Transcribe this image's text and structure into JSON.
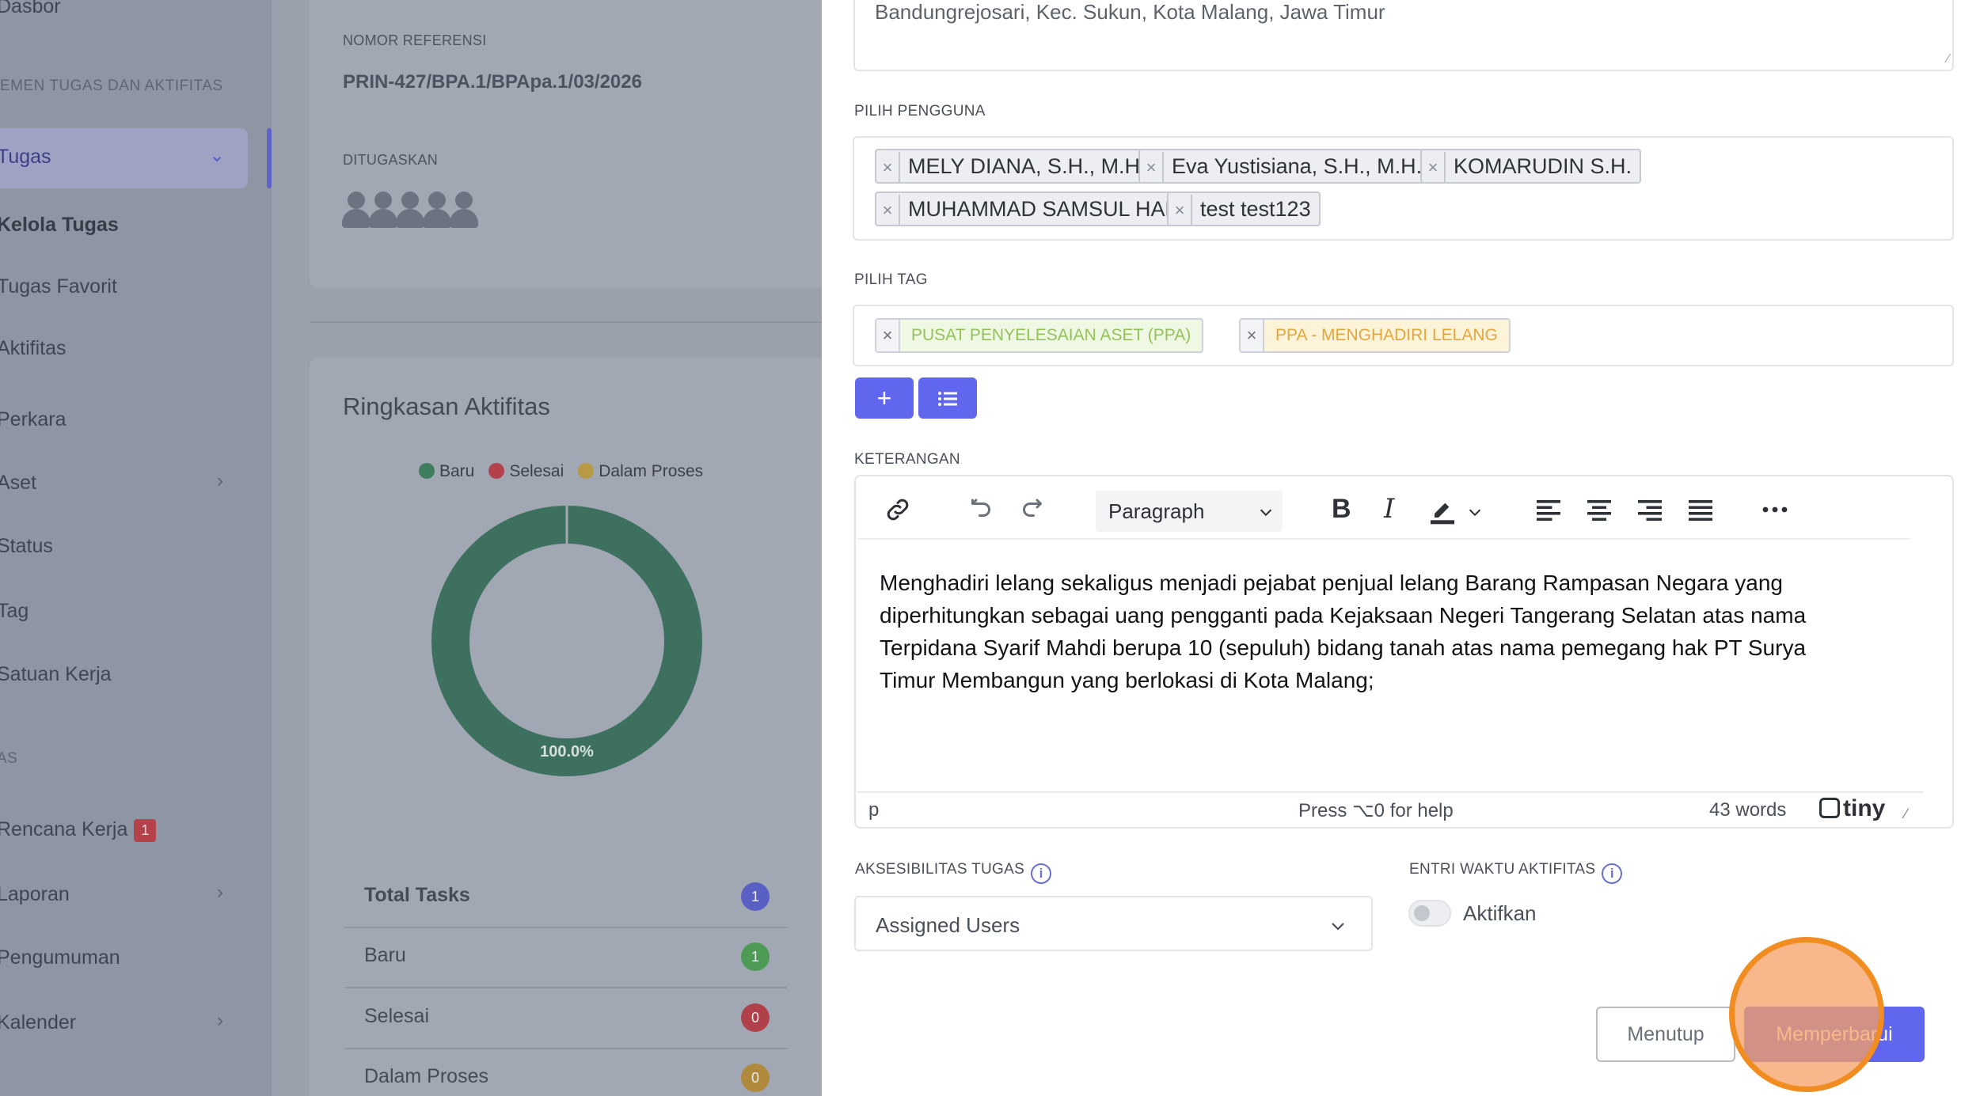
{
  "sidebar": {
    "items": [
      {
        "label": "Dasbor"
      },
      {
        "label": "Tugas"
      },
      {
        "label": "Kelola Tugas"
      },
      {
        "label": "Tugas Favorit"
      },
      {
        "label": "Aktifitas"
      },
      {
        "label": "Perkara"
      },
      {
        "label": "Aset"
      },
      {
        "label": "Status"
      },
      {
        "label": "Tag"
      },
      {
        "label": "Satuan Kerja"
      },
      {
        "label": "Rencana Kerja",
        "badge": "1"
      },
      {
        "label": "Laporan"
      },
      {
        "label": "Pengumuman"
      },
      {
        "label": "Kalender"
      }
    ],
    "sections": [
      "EMEN TUGAS DAN AKTIFITAS",
      "AS"
    ]
  },
  "task_card": {
    "ref_caption": "NOMOR REFERENSI",
    "ref_value": "PRIN-427/BPA.1/BPApa.1/03/2026",
    "assigned_caption": "DITUGASKAN"
  },
  "summary": {
    "title": "Ringkasan Aktifitas",
    "legend": [
      {
        "name": "Baru",
        "color": "#3e7d5e"
      },
      {
        "name": "Selesai",
        "color": "#b4424c"
      },
      {
        "name": "Dalam Proses",
        "color": "#b89a45"
      }
    ],
    "donut_label": "100.0%",
    "stats": [
      {
        "label": "Total Tasks",
        "count": "1",
        "color": "#5a5fc4",
        "bold": true
      },
      {
        "label": "Baru",
        "count": "1",
        "color": "#4d9b54"
      },
      {
        "label": "Selesai",
        "count": "0",
        "color": "#b0404a"
      },
      {
        "label": "Dalam Proses",
        "count": "0",
        "color": "#b08a3c"
      }
    ]
  },
  "chart_data": {
    "type": "pie",
    "categories": [
      "Baru",
      "Selesai",
      "Dalam Proses"
    ],
    "values": [
      100.0,
      0,
      0
    ],
    "title": "Ringkasan Aktifitas",
    "legend": "top"
  },
  "form": {
    "address_value": "Bandungrejosari, Kec. Sukun, Kota Malang, Jawa Timur",
    "users_label": "PILIH PENGGUNA",
    "users": [
      "MELY DIANA, S.H., M.H.",
      "Eva Yustisiana, S.H., M.H.",
      "KOMARUDIN S.H.",
      "MUHAMMAD SAMSUL HADI",
      "test test123"
    ],
    "tags_label": "PILIH TAG",
    "tags": [
      {
        "label": "PUSAT PENYELESAIAN ASET (PPA)",
        "bg": "#eef8e2",
        "fg": "#93c15b"
      },
      {
        "label": "PPA - MENGHADIRI LELANG",
        "bg": "#fdf3d9",
        "fg": "#e2a73d"
      }
    ],
    "add_btn": "+",
    "list_btn": "≡",
    "desc_label": "KETERANGAN",
    "editor": {
      "block_format": "Paragraph",
      "content": "Menghadiri lelang sekaligus menjadi pejabat penjual lelang Barang Rampasan Negara yang diperhitungkan sebagai uang pengganti pada Kejaksaan Negeri Tangerang Selatan atas nama Terpidana Syarif Mahdi berupa 10 (sepuluh) bidang tanah atas nama pemegang hak PT Surya Timur Membangun yang berlokasi di Kota Malang;",
      "path": "p",
      "help": "Press ⌥0 for help",
      "words": "43 words",
      "brand": "tiny"
    },
    "access_label": "AKSESIBILITAS TUGAS",
    "access_value": "Assigned Users",
    "entry_label": "ENTRI WAKTU AKTIFITAS",
    "toggle_label": "Aktifkan",
    "close_btn": "Menutup",
    "update_btn": "Memperbarui"
  }
}
